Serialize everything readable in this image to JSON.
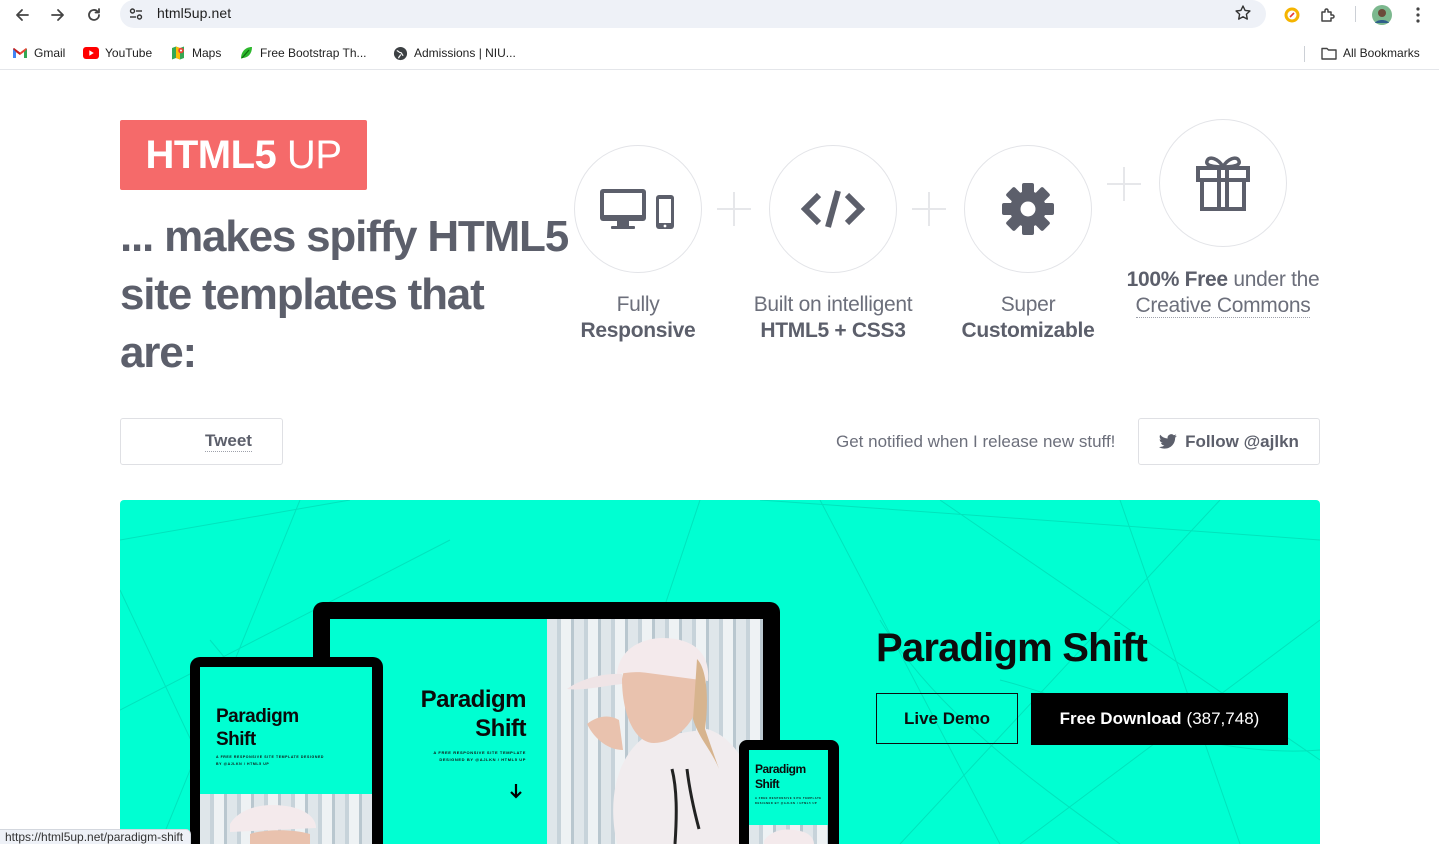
{
  "browser": {
    "url": "html5up.net",
    "bookmarks": [
      {
        "label": "Gmail",
        "icon": "gmail-icon"
      },
      {
        "label": "YouTube",
        "icon": "youtube-icon"
      },
      {
        "label": "Maps",
        "icon": "maps-icon"
      },
      {
        "label": "Free Bootstrap Th...",
        "icon": "bootstrap-leaf-icon"
      },
      {
        "label": "Admissions | NIU...",
        "icon": "globe-icon"
      }
    ],
    "all_bookmarks_label": "All Bookmarks",
    "status_url": "https://html5up.net/paradigm-shift"
  },
  "hero": {
    "logo_bold": "HTML5",
    "logo_light": " UP",
    "tagline": {
      "t1": "... makes ",
      "t2": "spiffy HTML5 site templates",
      "t3": " that are:"
    }
  },
  "features": [
    {
      "icon": "devices-icon",
      "line1": "Fully",
      "line2": "Responsive"
    },
    {
      "icon": "code-icon",
      "line1": "Built on intelligent",
      "line2": "HTML5 + CSS3"
    },
    {
      "icon": "gear-icon",
      "line1": "Super",
      "line2": "Customizable"
    },
    {
      "icon": "gift-icon",
      "bold": "100% Free",
      "rest": " under the",
      "link": "Creative Commons"
    }
  ],
  "social": {
    "tweet_label": "Tweet",
    "notify_text": "Get notified when I release new stuff!",
    "follow_label": "Follow @ajlkn"
  },
  "showcase": {
    "accent": "#00ffd2",
    "title": "Paradigm Shift",
    "mock_title_l1": "Paradigm",
    "mock_title_l2": "Shift",
    "mock_sub_l1": "A FREE RESPONSIVE SITE TEMPLATE",
    "mock_sub_l2": "DESIGNED BY @AJLKN / HTML5 UP",
    "mock_tablet_sub_l1": "A FREE RESPONSIVE SITE TEMPLATE DESIGNED",
    "mock_tablet_sub_l2": "BY @AJLKN / HTML5 UP",
    "mock_phone_sub_l1": "A FREE RESPONSIVE SITE TEMPLATE",
    "mock_phone_sub_l2": "DESIGNED BY @AJLKN / HTML5 UP",
    "live_demo_label": "Live Demo",
    "download_label": "Free Download",
    "download_count": "(387,748)"
  }
}
